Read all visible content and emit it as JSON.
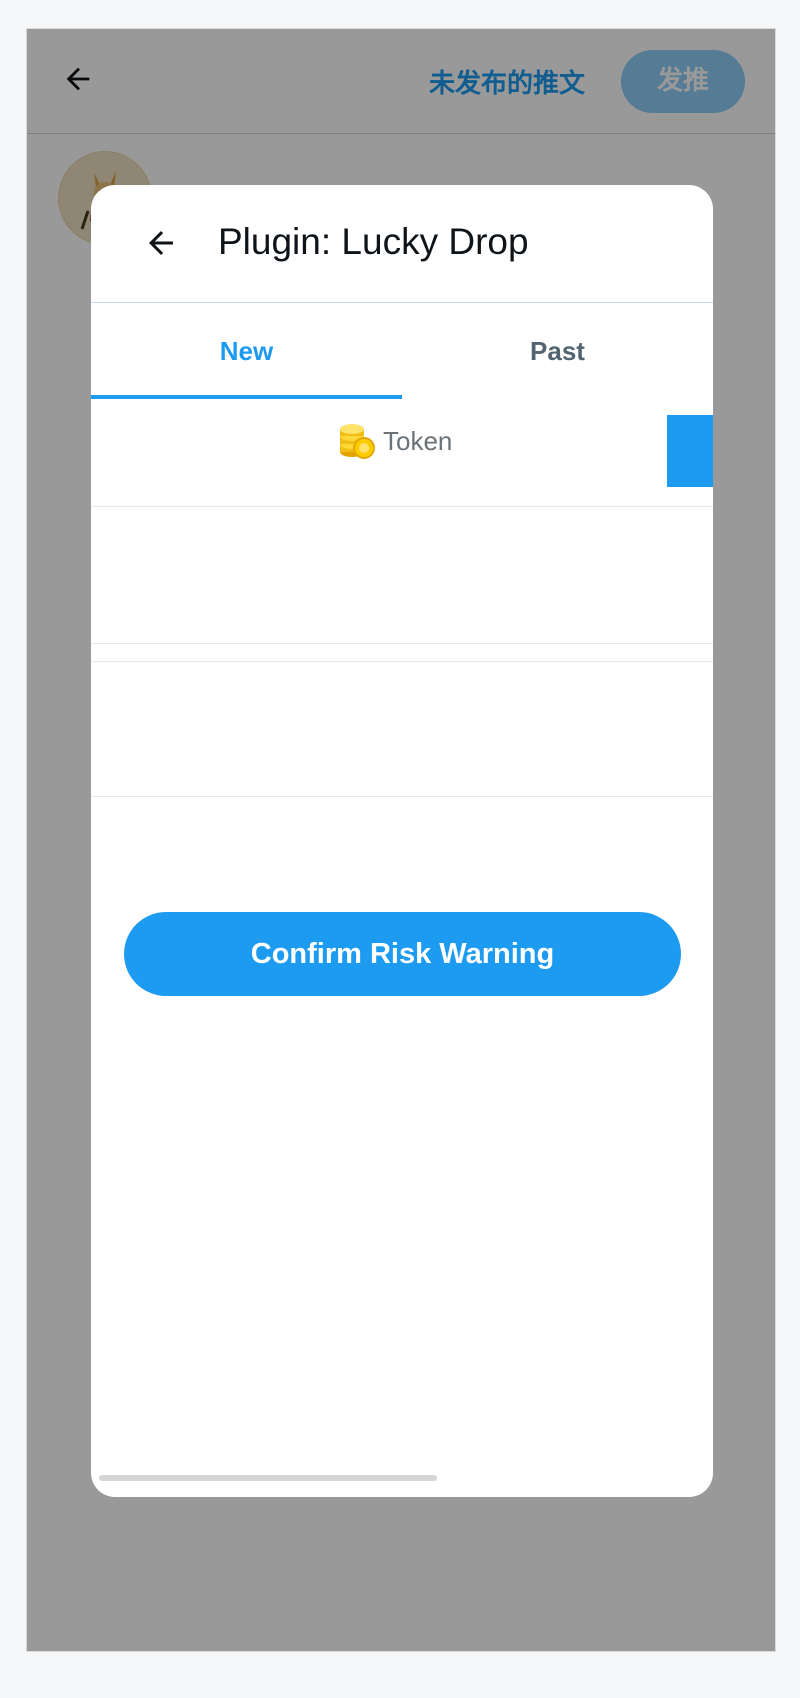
{
  "compose": {
    "drafts_label": "未发布的推文",
    "tweet_button_label": "发推"
  },
  "dialog": {
    "title": "Plugin: Lucky Drop",
    "tabs": [
      {
        "label": "New",
        "active": true
      },
      {
        "label": "Past",
        "active": false
      }
    ],
    "token_label": "Token",
    "confirm_label": "Confirm Risk Warning"
  },
  "colors": {
    "accent": "#1d9bf0",
    "backdrop": "rgba(0,0,0,0.4)",
    "tab_inactive": "#536471"
  },
  "icons": {
    "compose_back": "arrow-left-icon",
    "dialog_back": "arrow-left-icon",
    "token": "coins-icon"
  }
}
